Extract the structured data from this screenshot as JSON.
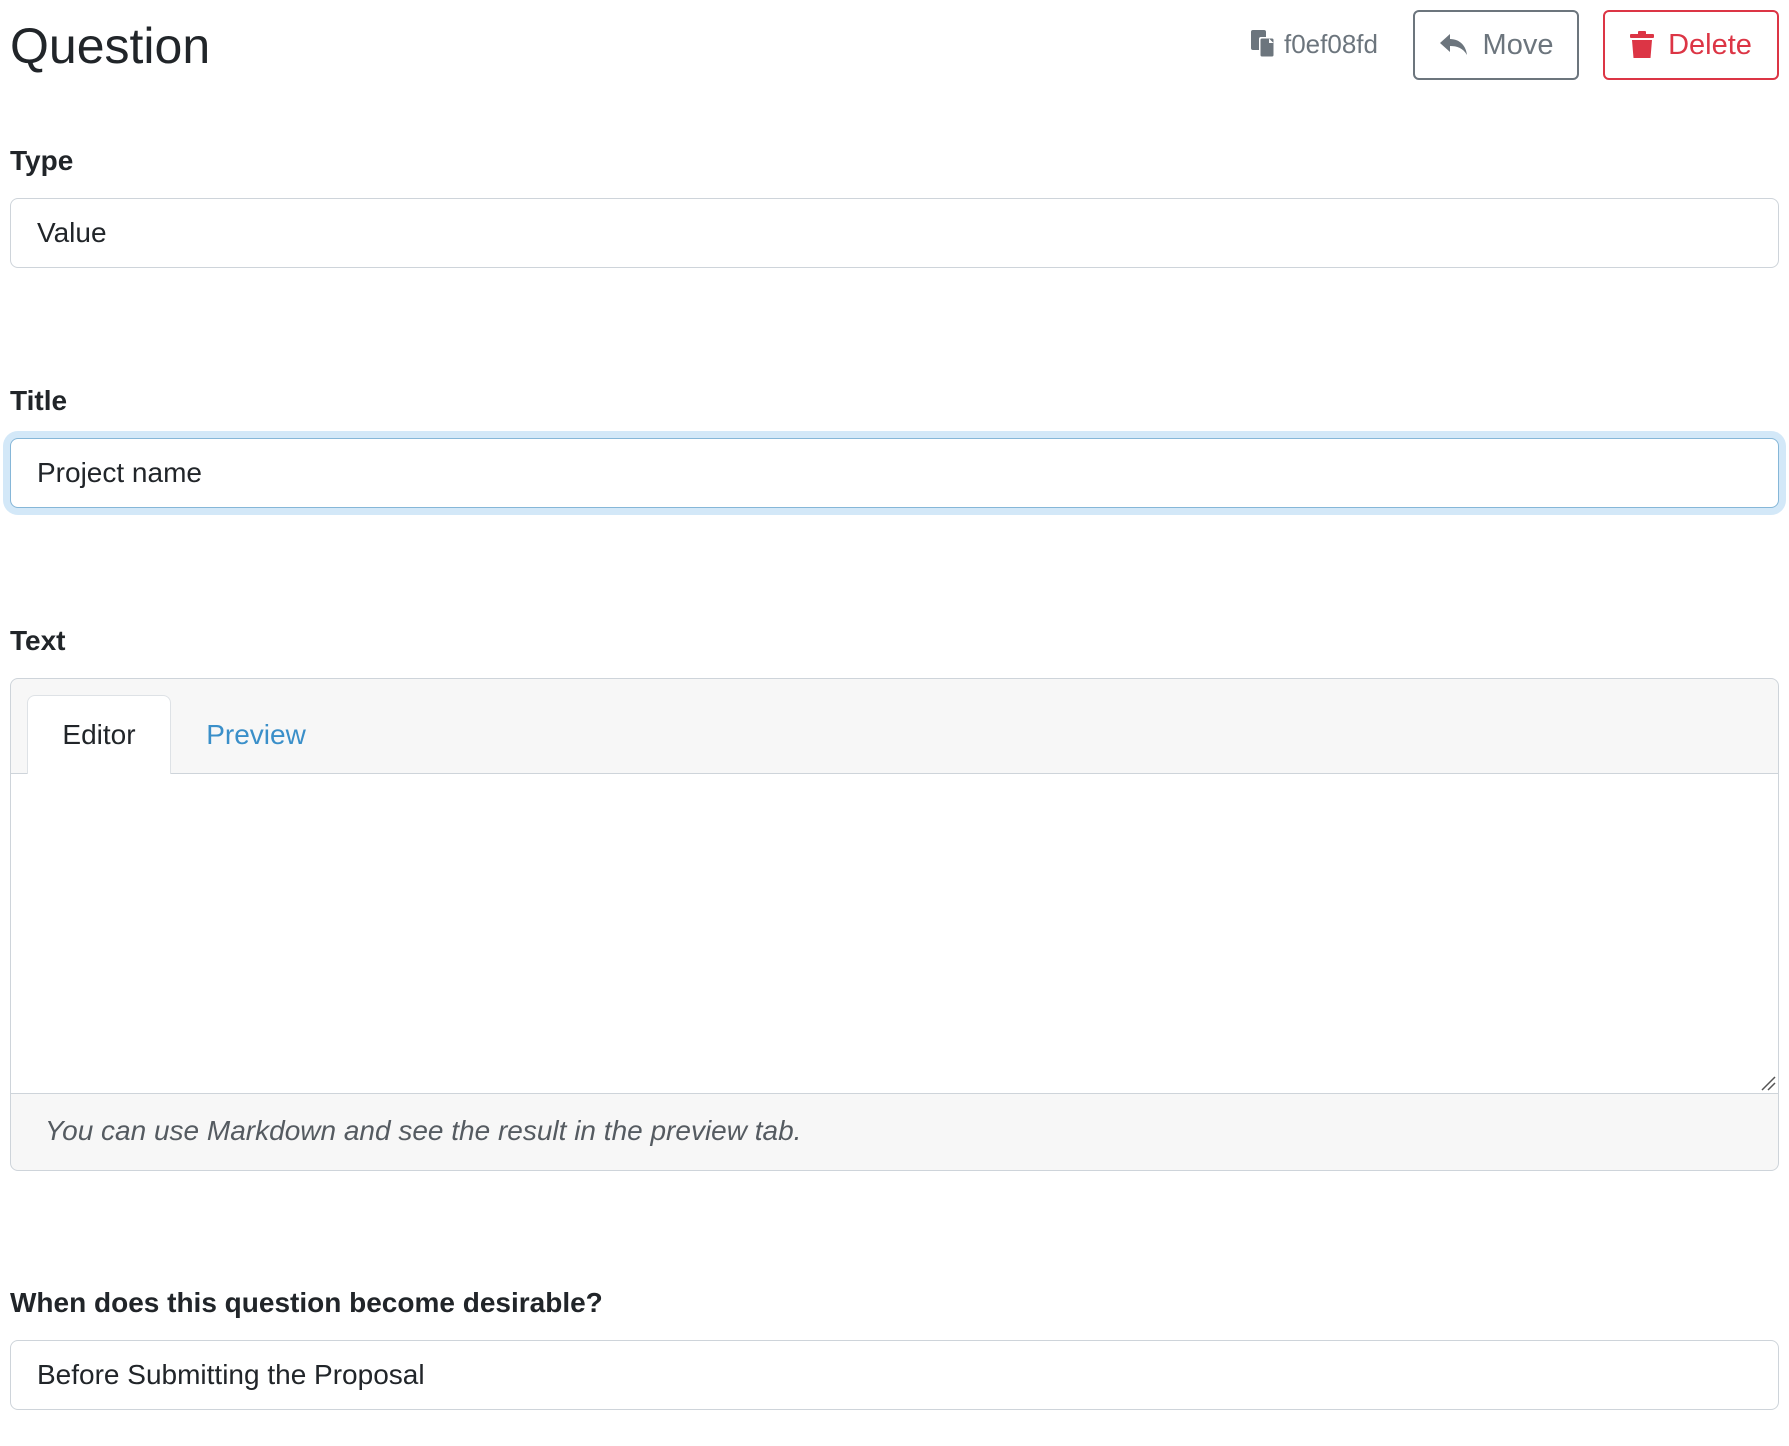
{
  "header": {
    "title": "Question",
    "uuid": "f0ef08fd",
    "move_label": "Move",
    "delete_label": "Delete",
    "icons": {
      "uuid": "copy-icon",
      "move": "reply-arrow-icon",
      "delete": "trash-icon"
    }
  },
  "form": {
    "type": {
      "label": "Type",
      "value": "Value"
    },
    "title": {
      "label": "Title",
      "value": "Project name"
    },
    "text": {
      "label": "Text",
      "tabs": [
        "Editor",
        "Preview"
      ],
      "active_tab": "Editor",
      "value": "",
      "help": "You can use Markdown and see the result in the preview tab."
    },
    "desirable": {
      "label": "When does this question become desirable?",
      "value": "Before Submitting the Proposal"
    }
  },
  "colors": {
    "move": "#6c757d",
    "delete": "#dc3545",
    "link": "#3a8fc9",
    "focus_ring": "#86b7d8"
  }
}
